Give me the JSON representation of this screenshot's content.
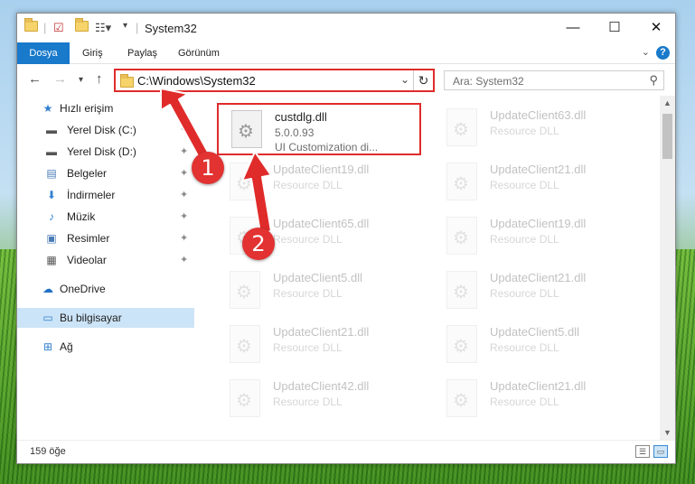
{
  "window": {
    "title": "System32",
    "minimize_glyph": "—",
    "maximize_glyph": "☐",
    "close_glyph": "✕"
  },
  "ribbon": {
    "tabs": [
      "Dosya",
      "Giriş",
      "Paylaş",
      "Görünüm"
    ],
    "help_glyph": "?",
    "collapse_glyph": "⌄"
  },
  "address": {
    "path": "C:\\Windows\\System32",
    "dropdown_glyph": "⌄",
    "refresh_glyph": "↻"
  },
  "search": {
    "placeholder": "Ara: System32",
    "icon": "search-icon"
  },
  "sidebar": {
    "items": [
      {
        "label": "Hızlı erişim",
        "icon": "star-icon",
        "glyph": "★",
        "color": "#2f7fd0",
        "pinned": false
      },
      {
        "label": "Yerel Disk (C:)",
        "icon": "drive-icon",
        "glyph": "▬",
        "color": "#555555",
        "pinned": true
      },
      {
        "label": "Yerel Disk (D:)",
        "icon": "drive-icon",
        "glyph": "▬",
        "color": "#555555",
        "pinned": true
      },
      {
        "label": "Belgeler",
        "icon": "documents-icon",
        "glyph": "▤",
        "color": "#4a7bb7",
        "pinned": true
      },
      {
        "label": "İndirmeler",
        "icon": "downloads-icon",
        "glyph": "⬇",
        "color": "#2f7fd0",
        "pinned": true
      },
      {
        "label": "Müzik",
        "icon": "music-icon",
        "glyph": "♪",
        "color": "#2f7fd0",
        "pinned": true
      },
      {
        "label": "Resimler",
        "icon": "pictures-icon",
        "glyph": "▣",
        "color": "#4a7bb7",
        "pinned": true
      },
      {
        "label": "Videolar",
        "icon": "videos-icon",
        "glyph": "▦",
        "color": "#555555",
        "pinned": true
      },
      {
        "label": "OneDrive",
        "icon": "cloud-icon",
        "glyph": "☁",
        "color": "#1f6fc4",
        "pinned": false
      },
      {
        "label": "Bu bilgisayar",
        "icon": "computer-icon",
        "glyph": "▭",
        "color": "#2f7fd0",
        "pinned": false
      },
      {
        "label": "Ağ",
        "icon": "network-icon",
        "glyph": "⊞",
        "color": "#2f7fd0",
        "pinned": false
      }
    ],
    "selected": "Bu bilgisayar",
    "pin_glyph": "📌"
  },
  "files": {
    "highlighted": {
      "name": "custdlg.dll",
      "version": "5.0.0.93",
      "description": "UI Customization di..."
    },
    "left_column": [
      {
        "name": "UpdateClient19.dll",
        "type": "Resource DLL"
      },
      {
        "name": "UpdateClient65.dll",
        "type": "Resource DLL"
      },
      {
        "name": "UpdateClient5.dll",
        "type": "Resource DLL"
      },
      {
        "name": "UpdateClient21.dll",
        "type": "Resource DLL"
      },
      {
        "name": "UpdateClient42.dll",
        "type": "Resource DLL"
      }
    ],
    "right_column": [
      {
        "name": "UpdateClient63.dll",
        "type": "Resource DLL"
      },
      {
        "name": "UpdateClient21.dll",
        "type": "Resource DLL"
      },
      {
        "name": "UpdateClient19.dll",
        "type": "Resource DLL"
      },
      {
        "name": "UpdateClient21.dll",
        "type": "Resource DLL"
      },
      {
        "name": "UpdateClient5.dll",
        "type": "Resource DLL"
      },
      {
        "name": "UpdateClient21.dll",
        "type": "Resource DLL"
      }
    ]
  },
  "status": {
    "item_count": "159 öğe"
  },
  "annotations": {
    "callout_1": "1",
    "callout_2": "2",
    "accent_color": "#e02b2b"
  }
}
